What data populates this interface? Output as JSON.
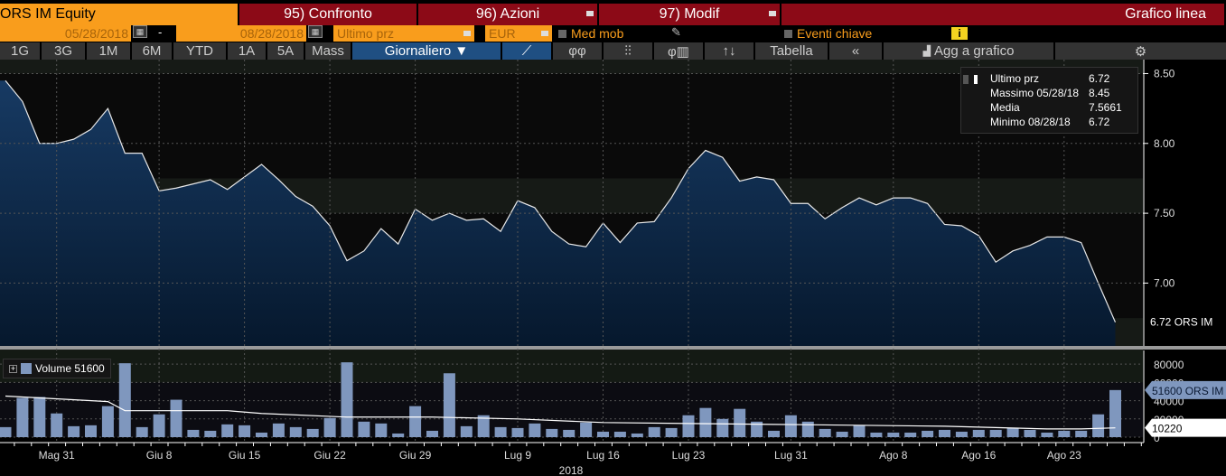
{
  "header": {
    "ticker": "ORS IM Equity",
    "confronto": "95) Confronto",
    "azioni": "96) Azioni",
    "modif": "97) Modif",
    "chart_type": "Grafico linea"
  },
  "controls": {
    "start_date": "05/28/2018",
    "dash": "-",
    "end_date": "08/28/2018",
    "field": "Ultimo prz",
    "currency": "EUR",
    "moving_avg": "Med mob",
    "key_events": "Eventi chiave",
    "info_icon": "i"
  },
  "toolbar": {
    "ranges": [
      "1G",
      "3G",
      "1M",
      "6M",
      "YTD",
      "1A",
      "5A",
      "Mass"
    ],
    "period": "Giornaliero ▼",
    "table": "Tabella",
    "collapse": "«",
    "add_to_chart": "Agg a grafico",
    "settings": "⚙"
  },
  "legend": {
    "rows": [
      {
        "label": "Ultimo prz",
        "value": "6.72"
      },
      {
        "label": "Massimo 05/28/18",
        "value": "8.45"
      },
      {
        "label": "Media",
        "value": "7.5661"
      },
      {
        "label": "Minimo 08/28/18",
        "value": "6.72"
      }
    ]
  },
  "volume_legend": {
    "label": "Volume 51600"
  },
  "colors": {
    "orange": "#f99d1c",
    "red": "#8c0a17",
    "bar": "#7f97be",
    "fill": "#0e2b4d"
  },
  "chart_data": {
    "type": "line",
    "price": {
      "ylim": [
        6.55,
        8.6
      ],
      "ticks": [
        "7.00",
        "7.50",
        "8.00",
        "8.50"
      ],
      "last_label": "6.72 ORS IM",
      "values": [
        8.45,
        8.3,
        8.0,
        8.0,
        8.03,
        8.1,
        8.25,
        7.93,
        7.93,
        7.66,
        7.68,
        7.71,
        7.74,
        7.67,
        7.76,
        7.85,
        7.74,
        7.62,
        7.55,
        7.41,
        7.16,
        7.23,
        7.39,
        7.28,
        7.53,
        7.45,
        7.5,
        7.45,
        7.46,
        7.37,
        7.59,
        7.54,
        7.37,
        7.28,
        7.26,
        7.43,
        7.29,
        7.43,
        7.44,
        7.61,
        7.82,
        7.95,
        7.9,
        7.73,
        7.76,
        7.74,
        7.57,
        7.57,
        7.46,
        7.54,
        7.61,
        7.56,
        7.61,
        7.61,
        7.57,
        7.42,
        7.41,
        7.34,
        7.15,
        7.23,
        7.27,
        7.33,
        7.33,
        7.29,
        7.0,
        6.72
      ]
    },
    "volume": {
      "ylim": [
        0,
        95000
      ],
      "ticks": [
        "0",
        "20000",
        "40000",
        "60000",
        "80000"
      ],
      "last_label": "51600 ORS IM",
      "ma_label": "10220",
      "values": [
        11000,
        43000,
        44000,
        26000,
        12000,
        13000,
        34000,
        81000,
        11000,
        25000,
        41000,
        8000,
        7000,
        14000,
        13000,
        5000,
        15000,
        11000,
        9000,
        21000,
        82000,
        17000,
        15000,
        4000,
        34000,
        7000,
        70000,
        12000,
        24000,
        11000,
        10000,
        15000,
        9000,
        8000,
        16000,
        6000,
        6000,
        4000,
        11000,
        10000,
        24000,
        32000,
        20000,
        31000,
        17000,
        7000,
        24000,
        17000,
        9000,
        6000,
        13000,
        5000,
        5000,
        5000,
        7000,
        8000,
        6000,
        8000,
        8000,
        10000,
        8000,
        5000,
        7000,
        7000,
        25000,
        51600
      ],
      "ma": [
        [
          0,
          45000
        ],
        [
          6,
          39000
        ],
        [
          7,
          29000
        ],
        [
          13,
          29000
        ],
        [
          15,
          26000
        ],
        [
          20,
          22000
        ],
        [
          25,
          22000
        ],
        [
          30,
          20000
        ],
        [
          35,
          16000
        ],
        [
          45,
          14000
        ],
        [
          55,
          12000
        ],
        [
          61,
          9000
        ],
        [
          63,
          9000
        ],
        [
          65,
          10220
        ]
      ]
    },
    "x_labels": [
      {
        "i": 3,
        "t": "Mag 31"
      },
      {
        "i": 9,
        "t": "Giu 8"
      },
      {
        "i": 14,
        "t": "Giu 15"
      },
      {
        "i": 19,
        "t": "Giu 22"
      },
      {
        "i": 24,
        "t": "Giu 29"
      },
      {
        "i": 30,
        "t": "Lug 9"
      },
      {
        "i": 35,
        "t": "Lug 16"
      },
      {
        "i": 40,
        "t": "Lug 23"
      },
      {
        "i": 46,
        "t": "Lug 31"
      },
      {
        "i": 52,
        "t": "Ago 8"
      },
      {
        "i": 57,
        "t": "Ago 16"
      },
      {
        "i": 62,
        "t": "Ago 23"
      }
    ],
    "year": "2018"
  }
}
